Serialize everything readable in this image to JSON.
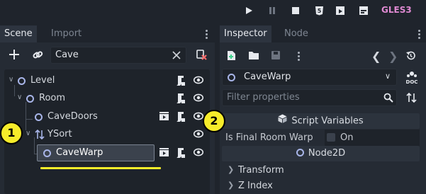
{
  "toolbar": {
    "icons": [
      "play-icon",
      "pause-icon",
      "stop-icon",
      "html5-icon",
      "play-scene-icon",
      "play-custom-scene-icon"
    ],
    "renderer_label": "GLES3"
  },
  "scene_dock": {
    "tabs": [
      {
        "label": "Scene",
        "active": true
      },
      {
        "label": "Import",
        "active": false
      }
    ],
    "filter": {
      "value": "Cave"
    },
    "tree": [
      {
        "label": "Level",
        "depth": 0,
        "expanded": true
      },
      {
        "label": "Room",
        "depth": 1,
        "expanded": true
      },
      {
        "label": "CaveDoors",
        "depth": 2
      },
      {
        "label": "YSort",
        "depth": 2,
        "expanded": true
      },
      {
        "label": "CaveWarp",
        "depth": 3,
        "selected": true
      }
    ]
  },
  "inspector": {
    "tabs": [
      {
        "label": "Inspector",
        "active": true
      },
      {
        "label": "Node",
        "active": false
      }
    ],
    "object_name": "CaveWarp",
    "filter_placeholder": "Filter properties",
    "script_variables_label": "Script Variables",
    "property": {
      "label": "Is Final Room Warp",
      "value_label": "On"
    },
    "class_label": "Node2D",
    "groups": [
      "Transform",
      "Z Index"
    ]
  },
  "callouts": [
    "1",
    "2"
  ],
  "colors": {
    "highlight_underline": "#f6ec2a",
    "node_icon": "#a8b5e8",
    "renderer": "#e08ad3"
  }
}
